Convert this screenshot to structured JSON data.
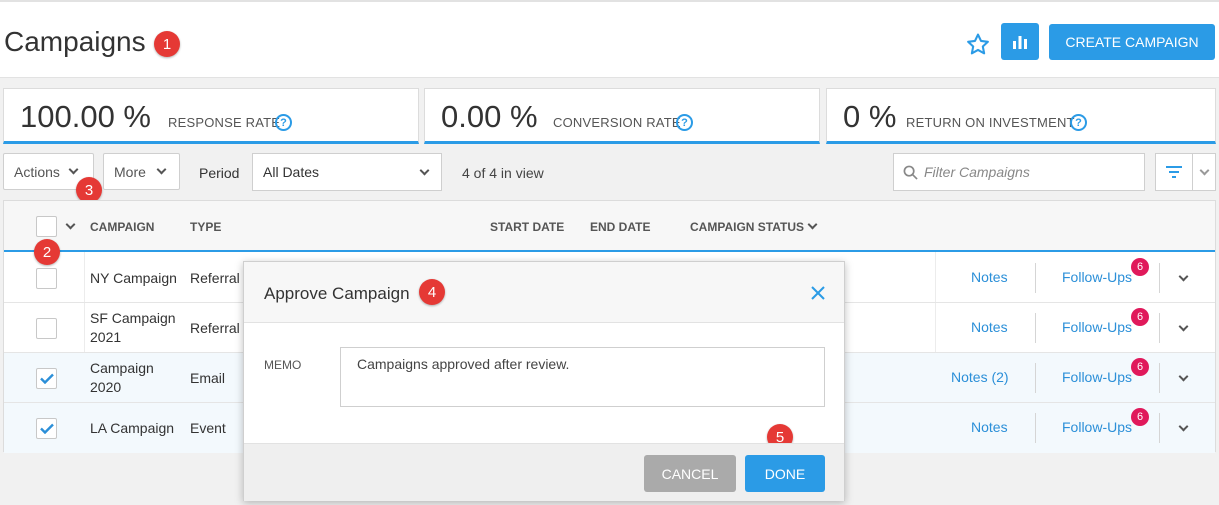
{
  "header": {
    "title": "Campaigns",
    "create_label": "CREATE CAMPAIGN"
  },
  "annotations": [
    "1",
    "2",
    "3",
    "4",
    "5"
  ],
  "kpis": [
    {
      "value": "100.00 %",
      "label": "RESPONSE RATE"
    },
    {
      "value": "0.00 %",
      "label": "CONVERSION RATE"
    },
    {
      "value": "0 %",
      "label": "RETURN ON INVESTMENT"
    }
  ],
  "help_glyph": "?",
  "toolbar": {
    "actions_label": "Actions",
    "more_label": "More",
    "period_label": "Period",
    "period_value": "All Dates",
    "in_view": "4 of 4 in view",
    "filter_placeholder": "Filter Campaigns"
  },
  "table": {
    "headers": {
      "campaign": "CAMPAIGN",
      "type": "TYPE",
      "start_date": "START DATE",
      "end_date": "END DATE",
      "status": "CAMPAIGN STATUS"
    },
    "rows": [
      {
        "name": "NY Campaign",
        "type": "Referral",
        "notes": "Notes",
        "followups": "Follow-Ups",
        "count": "6",
        "checked": false
      },
      {
        "name": "SF Campaign 2021",
        "type": "Referral",
        "notes": "Notes",
        "followups": "Follow-Ups",
        "count": "6",
        "checked": false
      },
      {
        "name": "Campaign 2020",
        "type": "Email",
        "notes": "Notes (2)",
        "followups": "Follow-Ups",
        "count": "6",
        "checked": true
      },
      {
        "name": "LA Campaign",
        "type": "Event",
        "notes": "Notes",
        "followups": "Follow-Ups",
        "count": "6",
        "checked": true
      }
    ]
  },
  "modal": {
    "title": "Approve Campaign",
    "memo_label": "MEMO",
    "memo_value": "Campaigns approved after review.",
    "cancel_label": "CANCEL",
    "done_label": "DONE"
  },
  "colors": {
    "accent": "#2b9be6",
    "badge": "#e53935",
    "count_badge": "#e0195b"
  }
}
